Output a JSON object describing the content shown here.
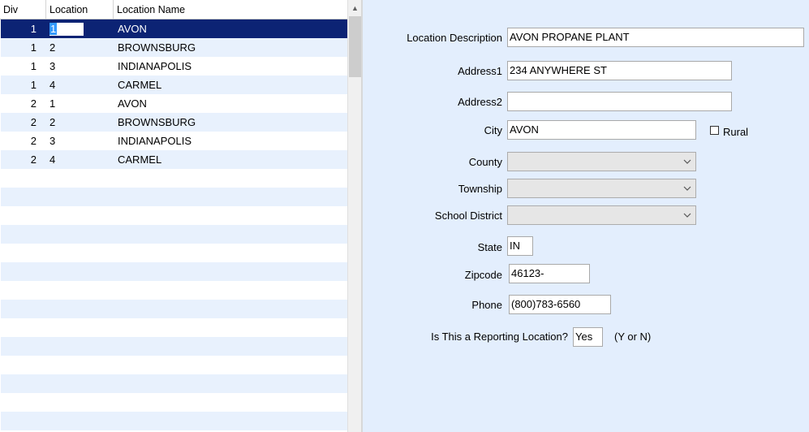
{
  "grid": {
    "columns": [
      "Div",
      "Location",
      "Location Name"
    ],
    "rows": [
      {
        "div": "1",
        "loc": "1",
        "name": "AVON"
      },
      {
        "div": "1",
        "loc": "2",
        "name": "BROWNSBURG"
      },
      {
        "div": "1",
        "loc": "3",
        "name": "INDIANAPOLIS"
      },
      {
        "div": "1",
        "loc": "4",
        "name": "CARMEL"
      },
      {
        "div": "2",
        "loc": "1",
        "name": "AVON"
      },
      {
        "div": "2",
        "loc": "2",
        "name": "BROWNSBURG"
      },
      {
        "div": "2",
        "loc": "3",
        "name": "INDIANAPOLIS"
      },
      {
        "div": "2",
        "loc": "4",
        "name": "CARMEL"
      }
    ],
    "selected_row": 0
  },
  "form": {
    "location_description": {
      "label": "Location Description",
      "value": "AVON PROPANE PLANT"
    },
    "address1": {
      "label": "Address1",
      "value": "234 ANYWHERE ST"
    },
    "address2": {
      "label": "Address2",
      "value": ""
    },
    "city": {
      "label": "City",
      "value": "AVON"
    },
    "rural": {
      "label": "Rural",
      "checked": false
    },
    "county": {
      "label": "County",
      "value": ""
    },
    "township": {
      "label": "Township",
      "value": ""
    },
    "school_district": {
      "label": "School District",
      "value": ""
    },
    "state": {
      "label": "State",
      "value": "IN"
    },
    "zipcode": {
      "label": "Zipcode",
      "value": "46123-"
    },
    "phone": {
      "label": "Phone",
      "value": "(800)783-6560"
    },
    "reporting": {
      "label": "Is This a Reporting Location?",
      "value": "Yes",
      "hint": "(Y or N)"
    }
  },
  "icons": {
    "scroll_up": "chevron-up-icon",
    "dropdown": "chevron-down-icon"
  },
  "colors": {
    "selected_row_bg": "#0c2374",
    "alt_row_bg": "#e8f1fd",
    "form_bg": "#e3eefd"
  }
}
